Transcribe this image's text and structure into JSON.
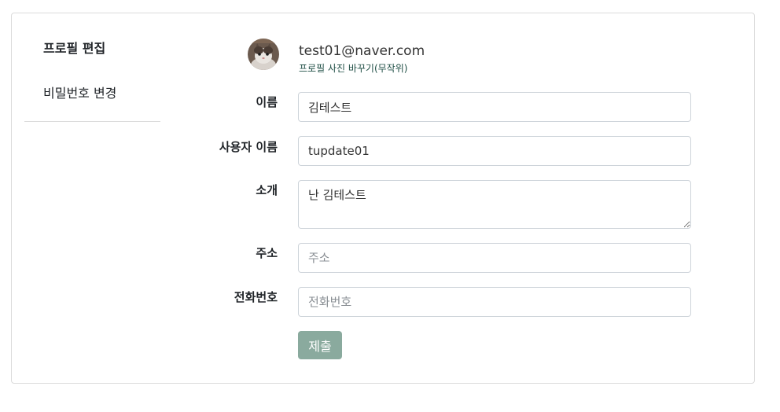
{
  "sidebar": {
    "items": [
      {
        "label": "프로필 편집",
        "active": true
      },
      {
        "label": "비밀번호 변경",
        "active": false
      }
    ]
  },
  "profile": {
    "email": "test01@naver.com",
    "change_photo_label": "프로필 사진 바꾸기(무작위)",
    "avatar_icon": "cat-photo-avatar"
  },
  "form": {
    "name": {
      "label": "이름",
      "value": "김테스트"
    },
    "username": {
      "label": "사용자 이름",
      "value": "tupdate01"
    },
    "bio": {
      "label": "소개",
      "value": "난 김테스트"
    },
    "address": {
      "label": "주소",
      "value": "",
      "placeholder": "주소"
    },
    "phone": {
      "label": "전화번호",
      "value": "",
      "placeholder": "전화번호"
    },
    "submit_label": "제출"
  },
  "colors": {
    "submit_bg": "#8aaa9e",
    "link": "#1f4e45",
    "border": "#dcdcdc"
  }
}
